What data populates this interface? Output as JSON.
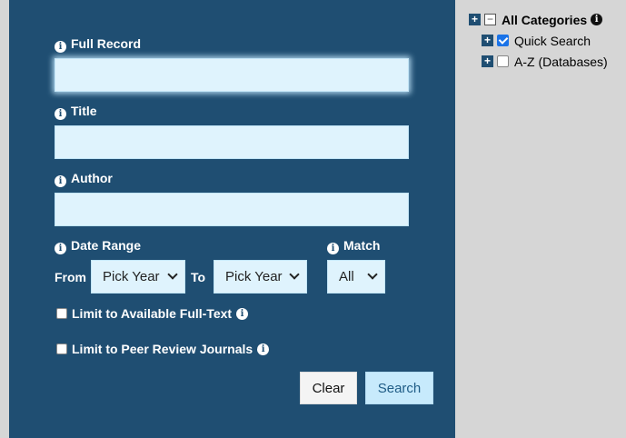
{
  "form": {
    "full_record_label": "Full Record",
    "title_label": "Title",
    "author_label": "Author",
    "date_range_label": "Date Range",
    "match_label": "Match",
    "from_label": "From",
    "to_label": "To",
    "from_year": "Pick Year",
    "to_year": "Pick Year",
    "match_value": "All",
    "full_text_label": "Limit to Available Full-Text",
    "peer_review_label": "Limit to Peer Review Journals",
    "clear_label": "Clear",
    "search_label": "Search",
    "info_glyph": "i"
  },
  "categories": {
    "root_label": "All Categories",
    "items": [
      {
        "label": "Quick Search",
        "checked": true
      },
      {
        "label": "A-Z (Databases)",
        "checked": false
      }
    ]
  },
  "colors": {
    "panel": "#1f4e72",
    "input_bg": "#dff3fd",
    "search_button": "#c7eafc",
    "page_bg": "#d6d6d6"
  }
}
